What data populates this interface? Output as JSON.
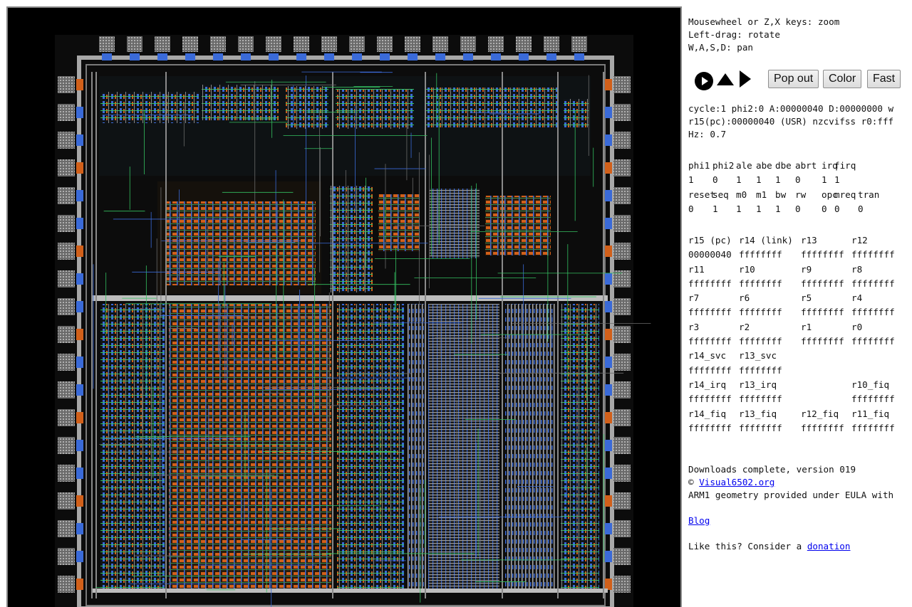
{
  "help": {
    "lines": [
      "Mousewheel or Z,X keys: zoom",
      "Left-drag: rotate",
      "W,A,S,D: pan"
    ]
  },
  "controls": {
    "icons": [
      "play-circle-icon",
      "step-up-icon",
      "step-forward-icon"
    ],
    "pop_out": "Pop out",
    "color": "Color",
    "fast": "Fast"
  },
  "status": {
    "line1": "cycle:1 phi2:0 A:00000040 D:00000000 w",
    "line2": "r15(pc):00000040 (USR) nzcvifss r0:fff",
    "line3": "Hz: 0.7"
  },
  "signals": {
    "rows": [
      [
        "phi1",
        "phi2",
        "ale",
        "abe",
        "dbe",
        "abrt",
        "irq",
        "firq",
        ""
      ],
      [
        "1",
        "0",
        "1",
        "1",
        "1",
        "0",
        "1",
        "1",
        ""
      ],
      [
        "reset",
        "seq",
        "m0",
        "m1",
        "bw",
        "rw",
        "opc",
        "mreq",
        "tran"
      ],
      [
        "0",
        "1",
        "1",
        "1",
        "1",
        "0",
        "0",
        "0",
        "0"
      ]
    ]
  },
  "registers": {
    "rows": [
      [
        "r15 (pc)",
        "r14 (link)",
        "r13",
        "r12"
      ],
      [
        "00000040",
        "ffffffff",
        "ffffffff",
        "ffffffff"
      ],
      [
        "r11",
        "r10",
        "r9",
        "r8"
      ],
      [
        "ffffffff",
        "ffffffff",
        "ffffffff",
        "ffffffff"
      ],
      [
        "r7",
        "r6",
        "r5",
        "r4"
      ],
      [
        "ffffffff",
        "ffffffff",
        "ffffffff",
        "ffffffff"
      ],
      [
        "r3",
        "r2",
        "r1",
        "r0"
      ],
      [
        "ffffffff",
        "ffffffff",
        "ffffffff",
        "ffffffff"
      ],
      [
        "r14_svc",
        "r13_svc",
        "",
        ""
      ],
      [
        "ffffffff",
        "ffffffff",
        "",
        ""
      ],
      [
        "r14_irq",
        "r13_irq",
        "",
        "r10_fiq"
      ],
      [
        "ffffffff",
        "ffffffff",
        "",
        "ffffffff"
      ],
      [
        "r14_fiq",
        "r13_fiq",
        "r12_fiq",
        "r11_fiq"
      ],
      [
        "ffffffff",
        "ffffffff",
        "ffffffff",
        "ffffffff"
      ]
    ]
  },
  "footer": {
    "downloads": "Downloads complete, version 019",
    "copyright_symbol": "©",
    "visual6502_link": "Visual6502.org",
    "eula": "ARM1 geometry provided under EULA with",
    "blog_link": "Blog",
    "donation_prefix": "Like this? Consider a ",
    "donation_link": "donation"
  },
  "chip": {
    "background": "#000000",
    "metal": "#c8c8c8",
    "poly_color": "#d2601a",
    "diff_color": "#3a6ad8",
    "wire_color": "#34c060"
  }
}
